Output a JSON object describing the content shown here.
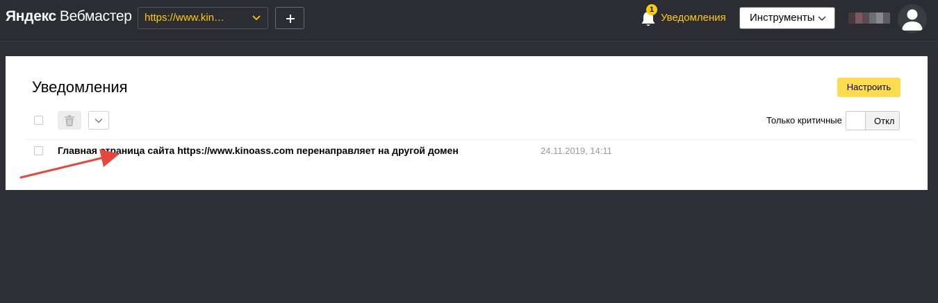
{
  "header": {
    "logo_brand": "Яндекс",
    "logo_product": "Вебмастер",
    "site_selector_value": "https://www.kin…",
    "notifications_count": "1",
    "notifications_label": "Уведомления",
    "tools_label": "Инструменты",
    "accent_color": "#ffcc00"
  },
  "page": {
    "title": "Уведомления",
    "configure_label": "Настроить",
    "critical_only_label": "Только критичные",
    "critical_only_state": "Откл"
  },
  "notifications": [
    {
      "title": "Главная страница сайта https://www.kinoass.com перенаправляет на другой домен",
      "date": "24.11.2019, 14:11"
    }
  ],
  "icons": [
    "chevron-down-icon",
    "plus-icon",
    "bell-icon",
    "trash-icon",
    "avatar-icon"
  ]
}
